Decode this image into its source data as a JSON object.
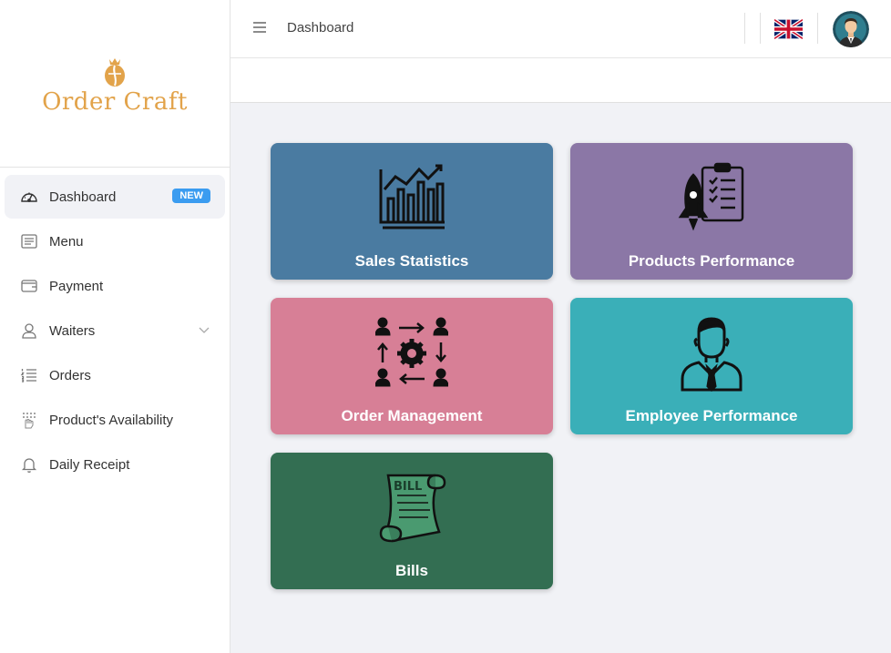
{
  "app": {
    "logo_text": "Order Craft"
  },
  "sidebar": {
    "items": [
      {
        "label": "Dashboard",
        "icon": "speedometer-icon",
        "badge": "NEW",
        "active": true
      },
      {
        "label": "Menu",
        "icon": "menu-list-icon"
      },
      {
        "label": "Payment",
        "icon": "wallet-icon"
      },
      {
        "label": "Waiters",
        "icon": "user-icon",
        "expandable": true
      },
      {
        "label": "Orders",
        "icon": "ordered-list-icon"
      },
      {
        "label": "Product's Availability",
        "icon": "hand-dots-icon"
      },
      {
        "label": "Daily Receipt",
        "icon": "bell-icon"
      }
    ]
  },
  "topbar": {
    "title": "Dashboard",
    "language_flag": "uk-flag-icon",
    "avatar": "user-avatar"
  },
  "cards": [
    {
      "title": "Sales Statistics",
      "color": "#4a7ba1",
      "icon": "bar-chart-icon"
    },
    {
      "title": "Products Performance",
      "color": "#8b77a6",
      "icon": "rocket-clipboard-icon"
    },
    {
      "title": "Order Management",
      "color": "#d77f96",
      "icon": "workflow-gear-icon"
    },
    {
      "title": "Employee Performance",
      "color": "#3aafb8",
      "icon": "employee-icon"
    },
    {
      "title": "Bills",
      "color": "#336e52",
      "icon": "bill-scroll-icon",
      "scroll_text": "BILL"
    }
  ],
  "colors": {
    "brand": "#e2a34a",
    "badge": "#3b9cf0",
    "background": "#f1f2f6"
  }
}
